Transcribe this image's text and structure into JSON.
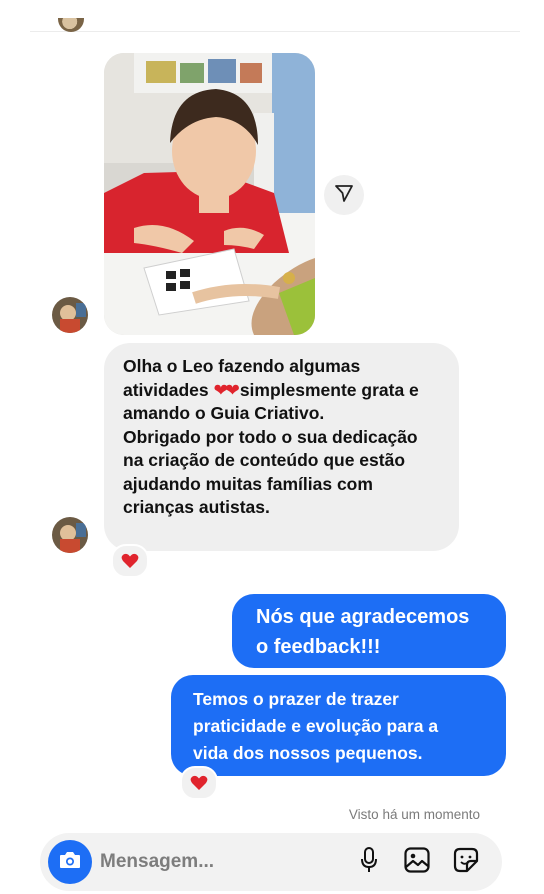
{
  "chat": {
    "incoming_message": "Olha o Leo fazendo algumas\natividades",
    "incoming_message_cont": "simplesmente grata e\namando o Guia Criativo.\nObrigado por todo o sua dedicação\nna criação de conteúdo que estão\najudando muitas famílias com\ncrianças autistas.",
    "inline_emoji": "❤❤",
    "outgoing_message_1": "Nós que agradecemos\no feedback!!!",
    "outgoing_message_2": "Temos o prazer de trazer\npraticidade e evolução para a\nvida dos nossos pequenos.",
    "reaction_emoji": "❤",
    "seen_status": "Visto há um momento"
  },
  "composer": {
    "placeholder": "Mensagem..."
  },
  "icons": {
    "share": "paper-plane-icon",
    "camera": "camera-icon",
    "mic": "microphone-icon",
    "gallery": "gallery-icon",
    "sticker": "sticker-icon"
  },
  "colors": {
    "outgoing_bubble": "#1d6ef5",
    "incoming_bubble": "#efefef",
    "reaction_heart": "#e0242d"
  }
}
